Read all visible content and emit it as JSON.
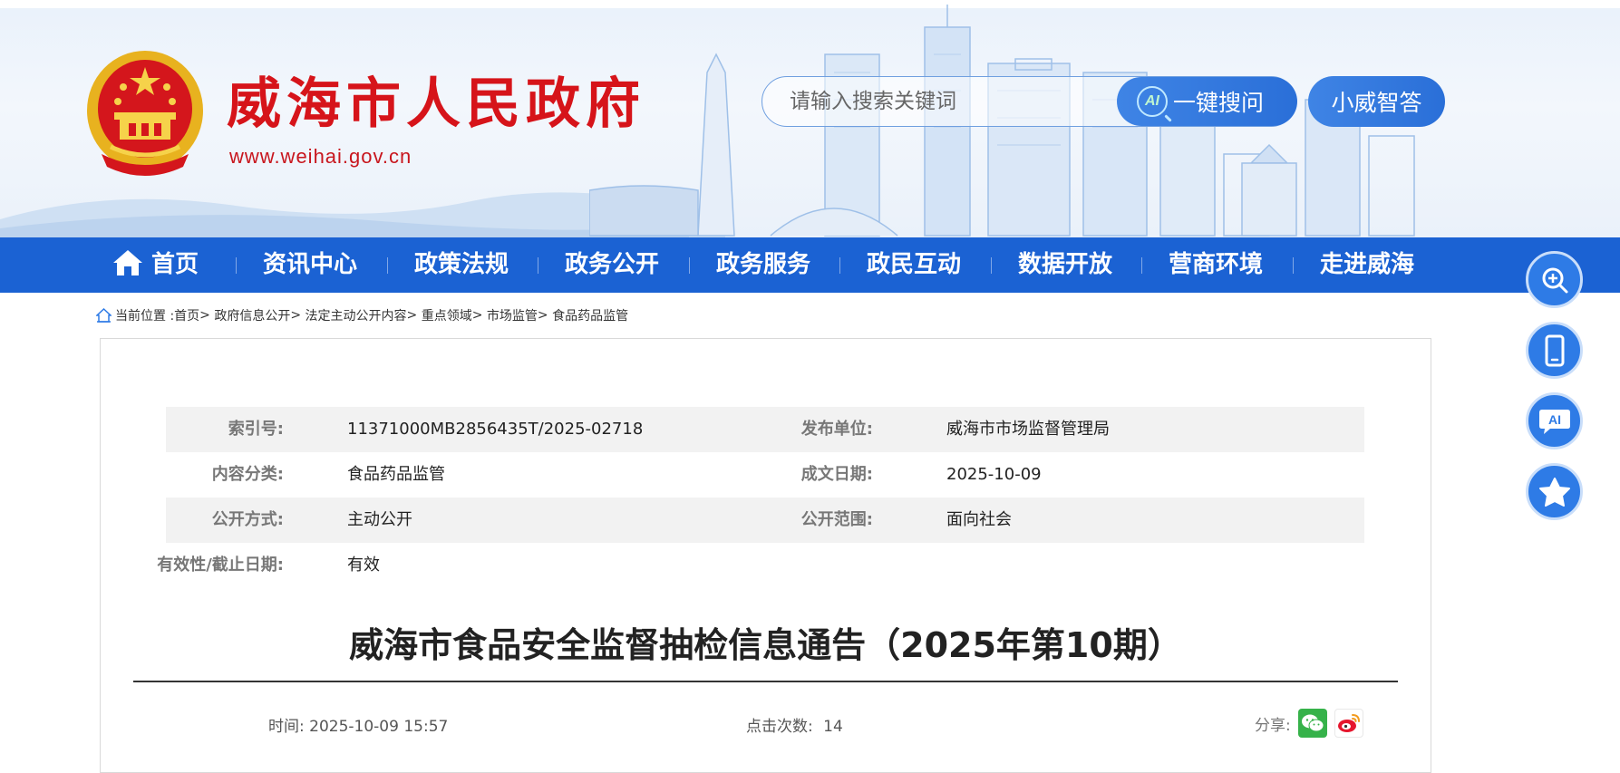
{
  "header": {
    "site_name": "威海市人民政府",
    "site_url": "www.weihai.gov.cn",
    "search_placeholder": "请输入搜索关键词",
    "ai_badge": "AI",
    "ai_search_label": "一键搜问",
    "xiaowei_label": "小威智答"
  },
  "nav": {
    "items": [
      "首页",
      "资讯中心",
      "政策法规",
      "政务公开",
      "政务服务",
      "政民互动",
      "数据开放",
      "营商环境",
      "走进威海"
    ]
  },
  "breadcrumb": {
    "prefix": "当前位置 :",
    "items": [
      "首页",
      "政府信息公开",
      "法定主动公开内容",
      "重点领域",
      "市场监管",
      "食品药品监管"
    ],
    "separator": ">"
  },
  "meta": {
    "rows": [
      {
        "label1": "索引号:",
        "value1": "11371000MB2856435T/2025-02718",
        "label2": "发布单位:",
        "value2": "威海市市场监督管理局"
      },
      {
        "label1": "内容分类:",
        "value1": "食品药品监管",
        "label2": "成文日期:",
        "value2": "2025-10-09"
      },
      {
        "label1": "公开方式:",
        "value1": "主动公开",
        "label2": "公开范围:",
        "value2": "面向社会"
      },
      {
        "label1": "有效性/截止日期:",
        "value1": "有效",
        "label2": "",
        "value2": ""
      }
    ]
  },
  "article": {
    "title": "威海市食品安全监督抽检信息通告（2025年第10期）",
    "time_label": "时间:",
    "time_value": "2025-10-09 15:57",
    "clicks_label": "点击次数:",
    "clicks_value": "14",
    "share_label": "分享:"
  },
  "icons": {
    "home": "home-icon",
    "zoom": "zoom-in-icon",
    "mobile": "mobile-phone-icon",
    "ai_chat": "ai-chat-icon",
    "star": "star-icon",
    "wechat": "wechat-icon",
    "weibo": "weibo-icon"
  },
  "colors": {
    "nav_blue": "#1b62d3",
    "brand_red": "#d6141a",
    "button_blue": "#2e7be6"
  }
}
